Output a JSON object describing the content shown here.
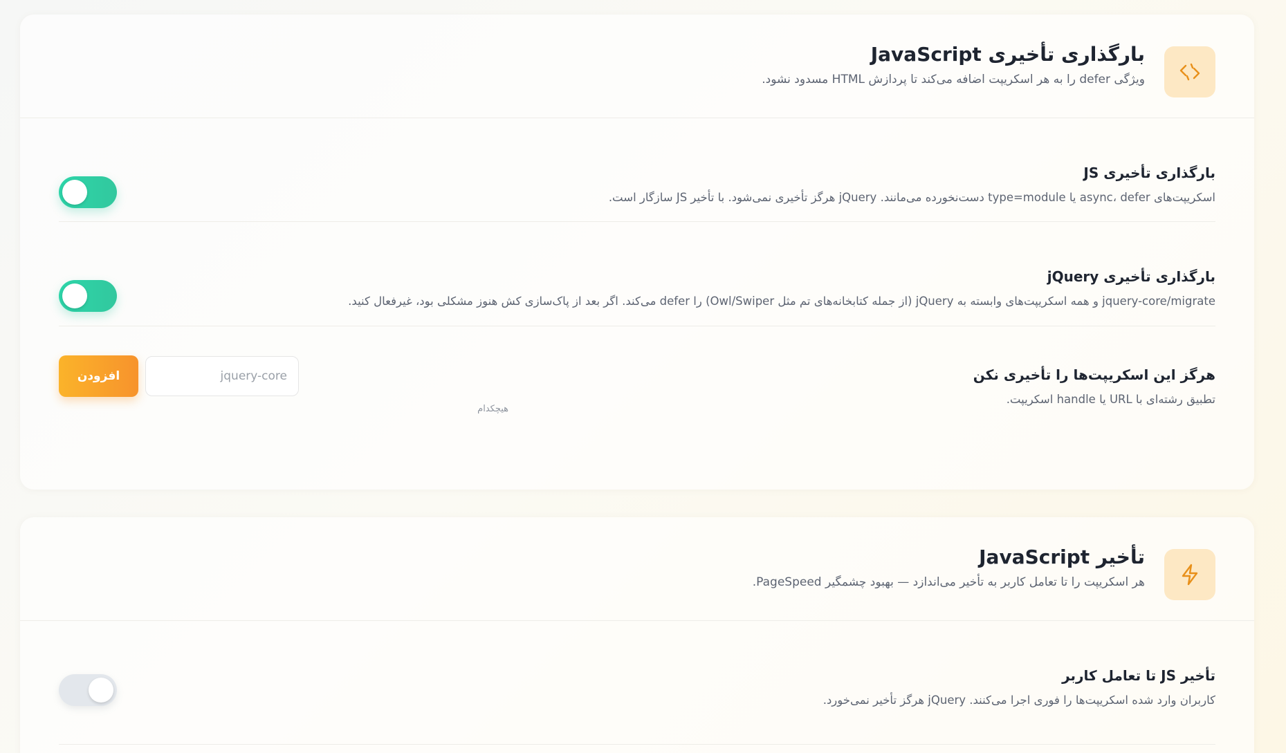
{
  "defer_section": {
    "title": "بارگذاری تأخیری JavaScript",
    "subtitle": "ویژگی defer را به هر اسکریپت اضافه می‌کند تا پردازش HTML مسدود نشود.",
    "icon": "code-icon",
    "rows": [
      {
        "title": "بارگذاری تأخیری JS",
        "description": "اسکریپت‌های async، defer یا type=module دست‌نخورده می‌مانند. jQuery هرگز تأخیری نمی‌شود. با تأخیر JS سازگار است.",
        "enabled": true
      },
      {
        "title": "بارگذاری تأخیری jQuery",
        "description": "jquery-core/migrate و همه اسکریپت‌های وابسته به jQuery (از جمله کتابخانه‌های تم مثل Owl/Swiper) را defer می‌کند. اگر بعد از پاک‌سازی کش هنوز مشکلی بود، غیرفعال کنید.",
        "enabled": true
      }
    ],
    "exclusions": {
      "title": "هرگز این اسکریپت‌ها را تأخیری نکن",
      "description": "تطبیق رشته‌ای با URL یا handle اسکریپت.",
      "input_placeholder": "jquery-core",
      "add_label": "افزودن",
      "empty_note": "هیچکدام"
    }
  },
  "delay_section": {
    "title": "تأخیر JavaScript",
    "subtitle": "هر اسکریپت را تا تعامل کاربر به تأخیر می‌اندازد — بهبود چشمگیر PageSpeed.",
    "icon": "lightning-icon",
    "rows": [
      {
        "title": "تأخیر JS تا تعامل کاربر",
        "description": "کاربران وارد شده اسکریپت‌ها را فوری اجرا می‌کنند. jQuery هرگز تأخیر نمی‌خورد.",
        "enabled": false
      }
    ]
  },
  "colors": {
    "accent_orange": "#f7a42b",
    "toggle_on": "#2dd5a9",
    "toggle_off": "#e3e7ec",
    "icon_bg": "#fde8c4"
  }
}
